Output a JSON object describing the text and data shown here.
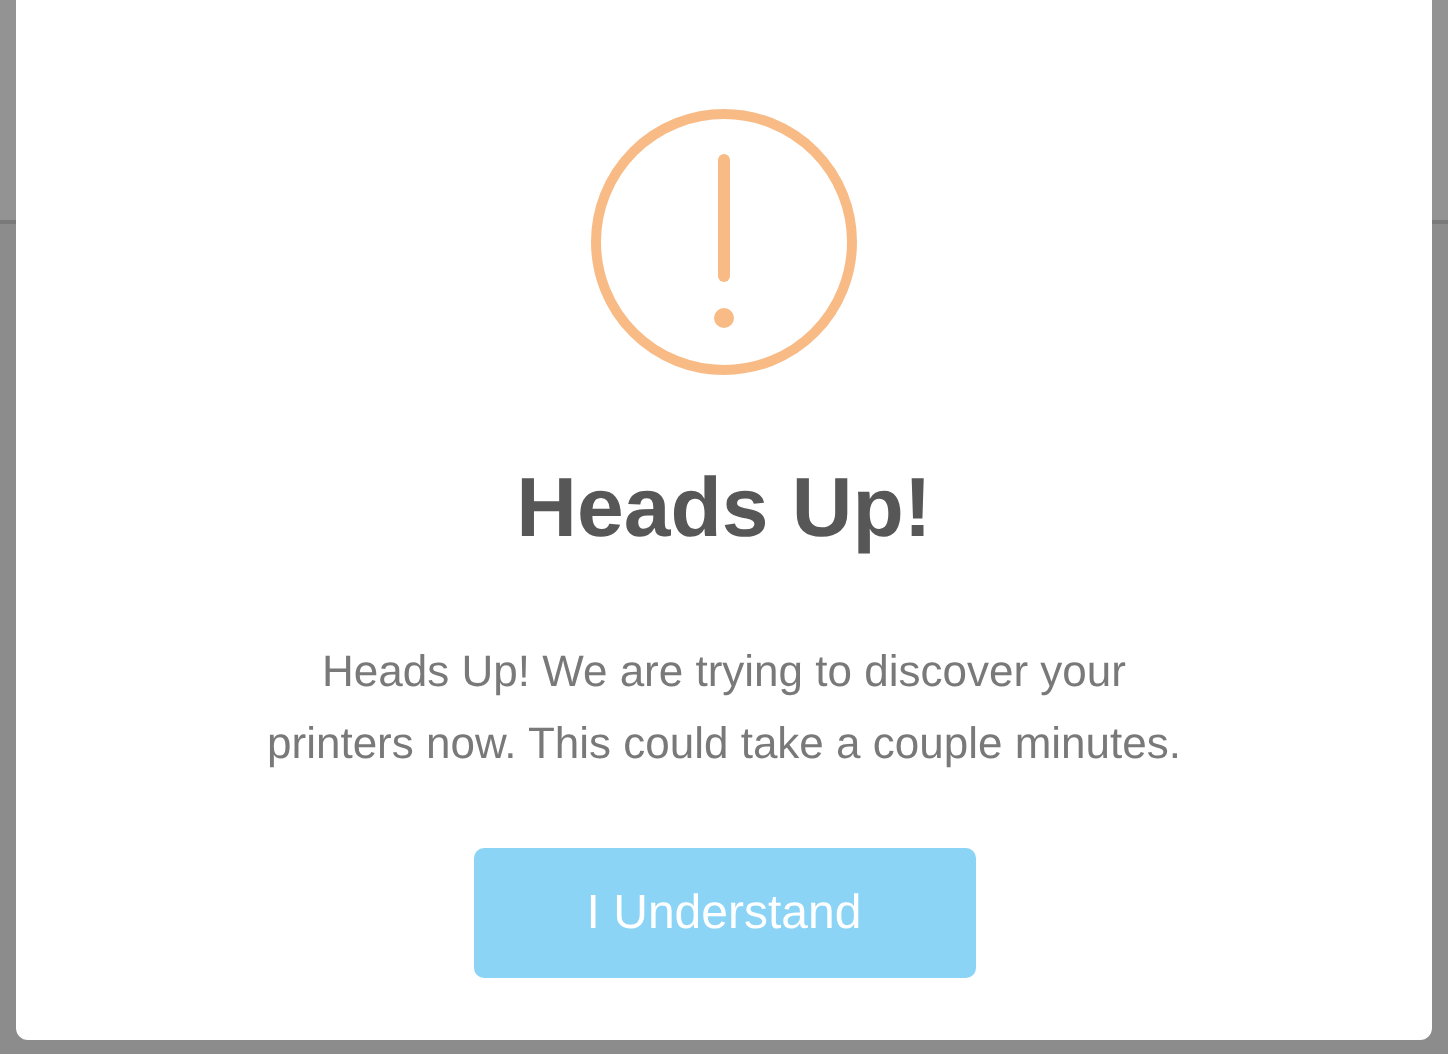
{
  "dialog": {
    "kind": "warning",
    "title": "Heads Up!",
    "message": "Heads Up! We are trying to discover your printers now. This could take a couple minutes.",
    "buttons": [
      {
        "label": "I Understand"
      }
    ]
  }
}
